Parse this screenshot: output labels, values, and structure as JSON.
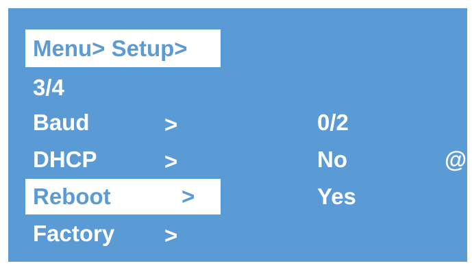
{
  "menu": {
    "breadcrumb": "Menu> Setup>",
    "page_indicator": "3/4",
    "items": [
      {
        "label": "Baud",
        "arrow": ">",
        "value": "0/2",
        "marker": ""
      },
      {
        "label": "DHCP",
        "arrow": ">",
        "value": "No",
        "marker": "@"
      },
      {
        "label": "Reboot",
        "arrow": ">",
        "value": "Yes",
        "marker": ""
      },
      {
        "label": "Factory",
        "arrow": ">",
        "value": "",
        "marker": ""
      }
    ],
    "selected_item": "Reboot"
  },
  "colors": {
    "background": "#5b9bd5",
    "text": "#ffffff",
    "highlight_bg": "#ffffff",
    "highlight_text": "#5b9bd5"
  }
}
